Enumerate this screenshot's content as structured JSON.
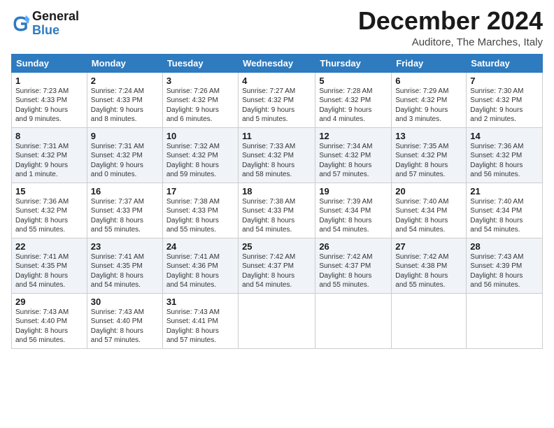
{
  "header": {
    "logo_line1": "General",
    "logo_line2": "Blue",
    "month_title": "December 2024",
    "subtitle": "Auditore, The Marches, Italy"
  },
  "weekdays": [
    "Sunday",
    "Monday",
    "Tuesday",
    "Wednesday",
    "Thursday",
    "Friday",
    "Saturday"
  ],
  "weeks": [
    [
      {
        "day": "1",
        "info": "Sunrise: 7:23 AM\nSunset: 4:33 PM\nDaylight: 9 hours\nand 9 minutes."
      },
      {
        "day": "2",
        "info": "Sunrise: 7:24 AM\nSunset: 4:33 PM\nDaylight: 9 hours\nand 8 minutes."
      },
      {
        "day": "3",
        "info": "Sunrise: 7:26 AM\nSunset: 4:32 PM\nDaylight: 9 hours\nand 6 minutes."
      },
      {
        "day": "4",
        "info": "Sunrise: 7:27 AM\nSunset: 4:32 PM\nDaylight: 9 hours\nand 5 minutes."
      },
      {
        "day": "5",
        "info": "Sunrise: 7:28 AM\nSunset: 4:32 PM\nDaylight: 9 hours\nand 4 minutes."
      },
      {
        "day": "6",
        "info": "Sunrise: 7:29 AM\nSunset: 4:32 PM\nDaylight: 9 hours\nand 3 minutes."
      },
      {
        "day": "7",
        "info": "Sunrise: 7:30 AM\nSunset: 4:32 PM\nDaylight: 9 hours\nand 2 minutes."
      }
    ],
    [
      {
        "day": "8",
        "info": "Sunrise: 7:31 AM\nSunset: 4:32 PM\nDaylight: 9 hours\nand 1 minute."
      },
      {
        "day": "9",
        "info": "Sunrise: 7:31 AM\nSunset: 4:32 PM\nDaylight: 9 hours\nand 0 minutes."
      },
      {
        "day": "10",
        "info": "Sunrise: 7:32 AM\nSunset: 4:32 PM\nDaylight: 8 hours\nand 59 minutes."
      },
      {
        "day": "11",
        "info": "Sunrise: 7:33 AM\nSunset: 4:32 PM\nDaylight: 8 hours\nand 58 minutes."
      },
      {
        "day": "12",
        "info": "Sunrise: 7:34 AM\nSunset: 4:32 PM\nDaylight: 8 hours\nand 57 minutes."
      },
      {
        "day": "13",
        "info": "Sunrise: 7:35 AM\nSunset: 4:32 PM\nDaylight: 8 hours\nand 57 minutes."
      },
      {
        "day": "14",
        "info": "Sunrise: 7:36 AM\nSunset: 4:32 PM\nDaylight: 8 hours\nand 56 minutes."
      }
    ],
    [
      {
        "day": "15",
        "info": "Sunrise: 7:36 AM\nSunset: 4:32 PM\nDaylight: 8 hours\nand 55 minutes."
      },
      {
        "day": "16",
        "info": "Sunrise: 7:37 AM\nSunset: 4:33 PM\nDaylight: 8 hours\nand 55 minutes."
      },
      {
        "day": "17",
        "info": "Sunrise: 7:38 AM\nSunset: 4:33 PM\nDaylight: 8 hours\nand 55 minutes."
      },
      {
        "day": "18",
        "info": "Sunrise: 7:38 AM\nSunset: 4:33 PM\nDaylight: 8 hours\nand 54 minutes."
      },
      {
        "day": "19",
        "info": "Sunrise: 7:39 AM\nSunset: 4:34 PM\nDaylight: 8 hours\nand 54 minutes."
      },
      {
        "day": "20",
        "info": "Sunrise: 7:40 AM\nSunset: 4:34 PM\nDaylight: 8 hours\nand 54 minutes."
      },
      {
        "day": "21",
        "info": "Sunrise: 7:40 AM\nSunset: 4:34 PM\nDaylight: 8 hours\nand 54 minutes."
      }
    ],
    [
      {
        "day": "22",
        "info": "Sunrise: 7:41 AM\nSunset: 4:35 PM\nDaylight: 8 hours\nand 54 minutes."
      },
      {
        "day": "23",
        "info": "Sunrise: 7:41 AM\nSunset: 4:35 PM\nDaylight: 8 hours\nand 54 minutes."
      },
      {
        "day": "24",
        "info": "Sunrise: 7:41 AM\nSunset: 4:36 PM\nDaylight: 8 hours\nand 54 minutes."
      },
      {
        "day": "25",
        "info": "Sunrise: 7:42 AM\nSunset: 4:37 PM\nDaylight: 8 hours\nand 54 minutes."
      },
      {
        "day": "26",
        "info": "Sunrise: 7:42 AM\nSunset: 4:37 PM\nDaylight: 8 hours\nand 55 minutes."
      },
      {
        "day": "27",
        "info": "Sunrise: 7:42 AM\nSunset: 4:38 PM\nDaylight: 8 hours\nand 55 minutes."
      },
      {
        "day": "28",
        "info": "Sunrise: 7:43 AM\nSunset: 4:39 PM\nDaylight: 8 hours\nand 56 minutes."
      }
    ],
    [
      {
        "day": "29",
        "info": "Sunrise: 7:43 AM\nSunset: 4:40 PM\nDaylight: 8 hours\nand 56 minutes."
      },
      {
        "day": "30",
        "info": "Sunrise: 7:43 AM\nSunset: 4:40 PM\nDaylight: 8 hours\nand 57 minutes."
      },
      {
        "day": "31",
        "info": "Sunrise: 7:43 AM\nSunset: 4:41 PM\nDaylight: 8 hours\nand 57 minutes."
      },
      null,
      null,
      null,
      null
    ]
  ]
}
